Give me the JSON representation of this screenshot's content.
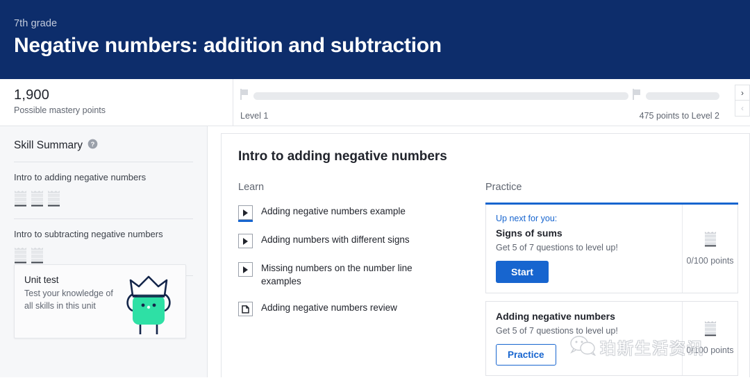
{
  "header": {
    "grade": "7th grade",
    "title": "Negative numbers: addition and subtraction"
  },
  "mastery": {
    "points": "1,900",
    "caption": "Possible mastery points",
    "level_label": "Level 1",
    "next_level_label": "475 points to Level 2",
    "next_arrow": "›",
    "prev_arrow": "‹"
  },
  "sidebar": {
    "title": "Skill Summary",
    "help_icon": "question-circle-icon",
    "skills": [
      {
        "name": "Intro to adding negative numbers",
        "icon_count": 3
      },
      {
        "name": "Intro to subtracting negative numbers",
        "icon_count": 2
      }
    ],
    "unit_test": {
      "title": "Unit test",
      "description": "Test your knowledge of all skills in this unit",
      "mascot_color": "#2ee0a5"
    }
  },
  "main": {
    "title": "Intro to adding negative numbers",
    "learn": {
      "heading": "Learn",
      "items": [
        {
          "label": "Adding negative numbers example",
          "icon": "video-play-icon",
          "progress": true
        },
        {
          "label": "Adding numbers with different signs",
          "icon": "video-play-icon",
          "progress": false
        },
        {
          "label": "Missing numbers on the number line examples",
          "icon": "video-play-icon",
          "progress": false
        },
        {
          "label": "Adding negative numbers review",
          "icon": "article-icon",
          "progress": false
        }
      ]
    },
    "practice": {
      "heading": "Practice",
      "cards": [
        {
          "up_next": "Up next for you:",
          "title": "Signs of sums",
          "subtitle": "Get 5 of 7 questions to level up!",
          "button": "Start",
          "points": "0/100\npoints"
        },
        {
          "up_next": "",
          "title": "Adding negative numbers",
          "subtitle": "Get 5 of 7 questions to level up!",
          "button": "Practice",
          "points": "0/100\npoints"
        }
      ]
    }
  },
  "watermark": {
    "text": "珀斯生活资讯",
    "icon": "wechat-icon"
  },
  "colors": {
    "header_navy": "#0d2d6b",
    "accent_blue": "#1765cf",
    "sidebar_bg": "#f6f7f9",
    "mascot_green": "#2ee0a5"
  }
}
